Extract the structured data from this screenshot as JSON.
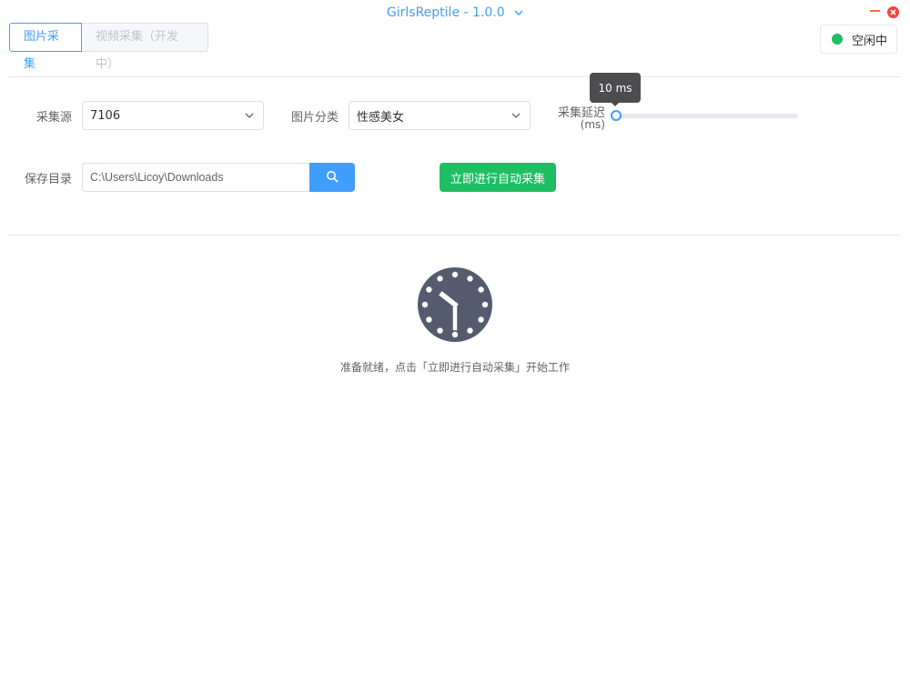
{
  "window": {
    "title": "GirlsReptile - 1.0.0"
  },
  "tabs": [
    {
      "label": "图片采集",
      "active": true
    },
    {
      "label": "视频采集（开发中）",
      "active": false
    }
  ],
  "status": {
    "label": "空闲中",
    "color": "#1ebf63"
  },
  "form": {
    "source_label": "采集源",
    "source_value": "7106",
    "category_label": "图片分类",
    "category_value": "性感美女",
    "delay_label": "采集延迟",
    "delay_unit": "(ms)",
    "delay_tooltip": "10 ms",
    "delay_value_ms": 10,
    "dir_label": "保存目录",
    "dir_value": "C:\\Users\\Licoy\\Downloads",
    "start_button": "立即进行自动采集"
  },
  "main": {
    "ready_text": "准备就绪，点击「立即进行自动采集」开始工作"
  },
  "colors": {
    "primary": "#409eff",
    "success": "#1ebf63",
    "clock": "#545b6e"
  },
  "icons": [
    "chevron-down-icon",
    "minimize-icon",
    "close-icon",
    "search-icon",
    "clock-icon"
  ]
}
